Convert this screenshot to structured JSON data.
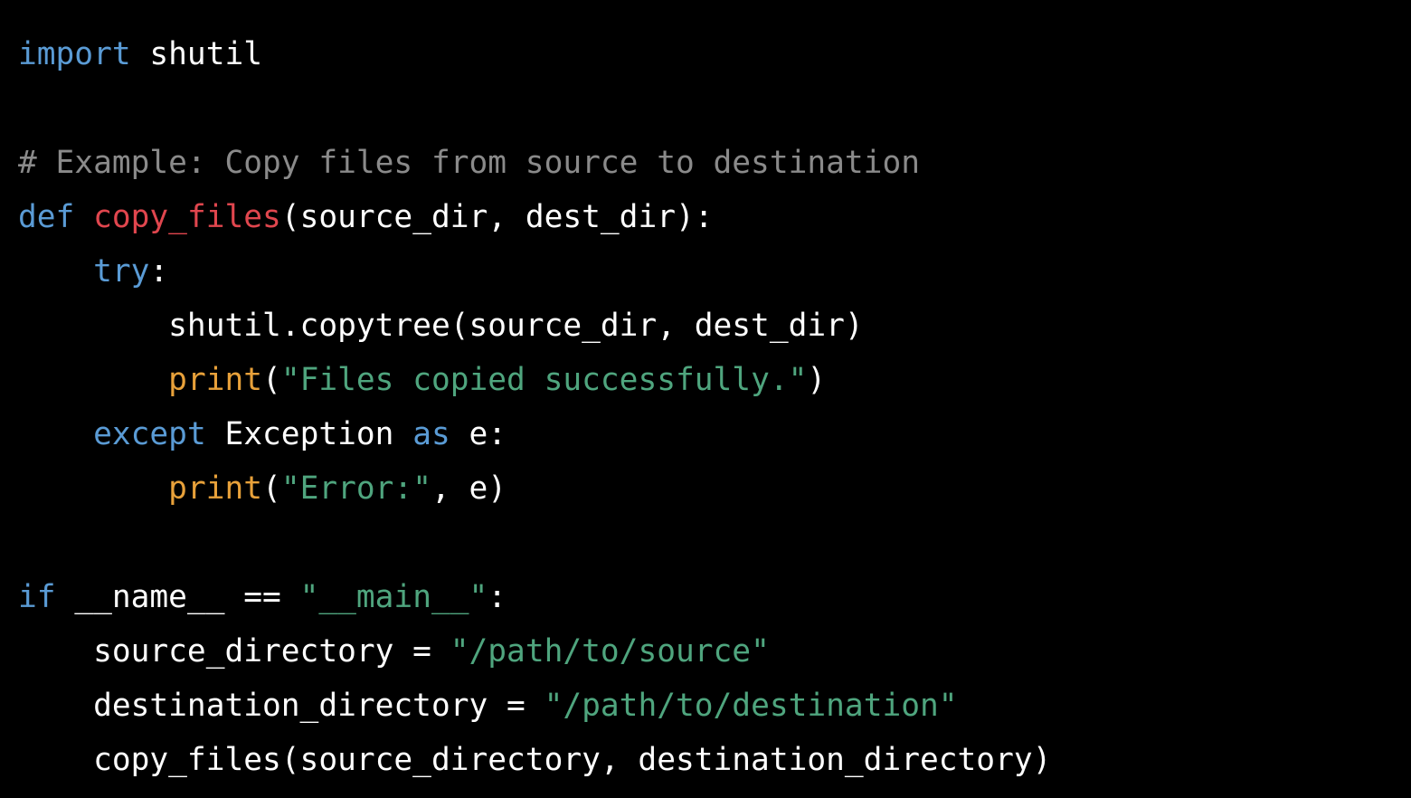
{
  "colors": {
    "background": "#000000",
    "keyword": "#5a9bd5",
    "function_name": "#e0464e",
    "builtin": "#e8a13a",
    "string": "#4fa57e",
    "comment": "#8a8a8a",
    "plain": "#ffffff"
  },
  "code": {
    "language": "python",
    "lines": [
      {
        "tokens": [
          {
            "t": "import",
            "k": "keyword"
          },
          {
            "t": " shutil",
            "k": "plain"
          }
        ]
      },
      {
        "tokens": []
      },
      {
        "tokens": [
          {
            "t": "# Example: Copy files from source to destination",
            "k": "comment"
          }
        ]
      },
      {
        "tokens": [
          {
            "t": "def",
            "k": "keyword"
          },
          {
            "t": " ",
            "k": "plain"
          },
          {
            "t": "copy_files",
            "k": "func"
          },
          {
            "t": "(source_dir, dest_dir):",
            "k": "plain"
          }
        ]
      },
      {
        "tokens": [
          {
            "t": "    ",
            "k": "plain"
          },
          {
            "t": "try",
            "k": "keyword"
          },
          {
            "t": ":",
            "k": "plain"
          }
        ]
      },
      {
        "tokens": [
          {
            "t": "        shutil.copytree(source_dir, dest_dir)",
            "k": "plain"
          }
        ]
      },
      {
        "tokens": [
          {
            "t": "        ",
            "k": "plain"
          },
          {
            "t": "print",
            "k": "builtin"
          },
          {
            "t": "(",
            "k": "plain"
          },
          {
            "t": "\"Files copied successfully.\"",
            "k": "string"
          },
          {
            "t": ")",
            "k": "plain"
          }
        ]
      },
      {
        "tokens": [
          {
            "t": "    ",
            "k": "plain"
          },
          {
            "t": "except",
            "k": "keyword"
          },
          {
            "t": " Exception ",
            "k": "plain"
          },
          {
            "t": "as",
            "k": "keyword"
          },
          {
            "t": " e:",
            "k": "plain"
          }
        ]
      },
      {
        "tokens": [
          {
            "t": "        ",
            "k": "plain"
          },
          {
            "t": "print",
            "k": "builtin"
          },
          {
            "t": "(",
            "k": "plain"
          },
          {
            "t": "\"Error:\"",
            "k": "string"
          },
          {
            "t": ", e)",
            "k": "plain"
          }
        ]
      },
      {
        "tokens": []
      },
      {
        "tokens": [
          {
            "t": "if",
            "k": "keyword"
          },
          {
            "t": " __name__ == ",
            "k": "plain"
          },
          {
            "t": "\"__main__\"",
            "k": "string"
          },
          {
            "t": ":",
            "k": "plain"
          }
        ]
      },
      {
        "tokens": [
          {
            "t": "    source_directory = ",
            "k": "plain"
          },
          {
            "t": "\"/path/to/source\"",
            "k": "string"
          }
        ]
      },
      {
        "tokens": [
          {
            "t": "    destination_directory = ",
            "k": "plain"
          },
          {
            "t": "\"/path/to/destination\"",
            "k": "string"
          }
        ]
      },
      {
        "tokens": [
          {
            "t": "    copy_files(source_directory, destination_directory)",
            "k": "plain"
          }
        ]
      }
    ]
  }
}
